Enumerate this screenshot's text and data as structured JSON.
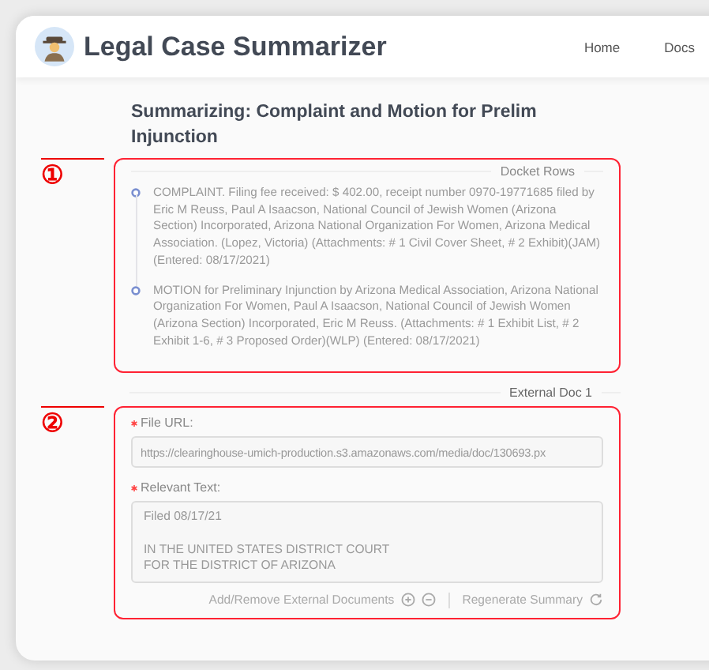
{
  "header": {
    "title": "Legal Case Summarizer",
    "nav": [
      "Home",
      "Docs"
    ]
  },
  "heading": "Summarizing: Complaint and Motion for Prelim Injunction",
  "annotations": [
    "①",
    "②"
  ],
  "docket": {
    "label": "Docket Rows",
    "rows": [
      "COMPLAINT. Filing fee received: $ 402.00, receipt number 0970-19771685 filed by Eric M Reuss, Paul A Isaacson, National Council of Jewish Women (Arizona Section) Incorporated, Arizona National Organization For Women, Arizona Medical Association. (Lopez, Victoria) (Attachments: # 1 Civil Cover Sheet, # 2 Exhibit)(JAM) (Entered: 08/17/2021)",
      "MOTION for Preliminary Injunction by Arizona Medical Association, Arizona National Organization For Women, Paul A Isaacson, National Council of Jewish Women (Arizona Section) Incorporated, Eric M Reuss. (Attachments: # 1 Exhibit List, # 2 Exhibit 1-6, # 3 Proposed Order)(WLP) (Entered: 08/17/2021)"
    ]
  },
  "external": {
    "label": "External Doc 1",
    "fields": [
      {
        "label": "File URL:",
        "required": true,
        "value": "https://clearinghouse-umich-production.s3.amazonaws.com/media/doc/130693.px"
      },
      {
        "label": "Relevant Text:",
        "required": true,
        "paragraphs": [
          [
            "Filed 08/17/21"
          ],
          [
            "IN THE UNITED STATES DISTRICT COURT",
            "FOR THE DISTRICT OF ARIZONA"
          ]
        ]
      }
    ],
    "add_remove": "Add/Remove External Documents",
    "regenerate": "Regenerate Summary"
  }
}
